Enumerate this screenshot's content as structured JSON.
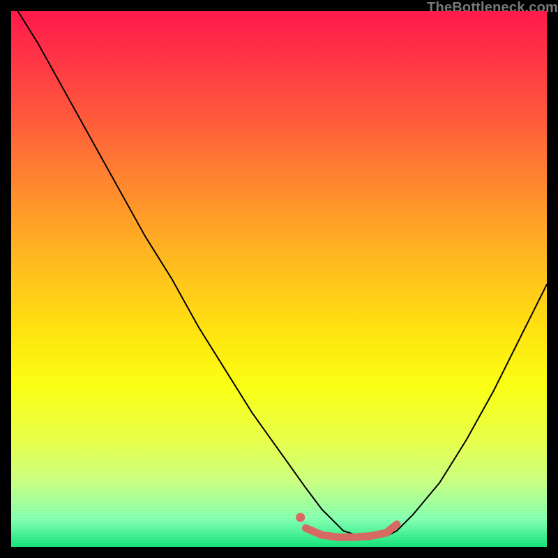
{
  "attribution": "TheBottleneck.com",
  "colors": {
    "curve": "#000000",
    "highlight": "#d66a63",
    "background_black": "#000000"
  },
  "chart_data": {
    "type": "line",
    "title": "",
    "xlabel": "",
    "ylabel": "",
    "xlim": [
      0,
      100
    ],
    "ylim": [
      0,
      100
    ],
    "series": [
      {
        "name": "bottleneck-curve",
        "x": [
          0,
          5,
          10,
          15,
          20,
          25,
          30,
          35,
          40,
          45,
          50,
          55,
          58,
          60,
          62,
          65,
          68,
          70,
          72,
          75,
          80,
          85,
          90,
          95,
          100
        ],
        "y": [
          102,
          94,
          85,
          76,
          67,
          58,
          50,
          41,
          33,
          25,
          18,
          11,
          7,
          5,
          3,
          2,
          2,
          2,
          3,
          6,
          12,
          20,
          29,
          39,
          49
        ]
      }
    ],
    "highlight_segment": {
      "x": [
        55,
        58,
        61,
        64,
        67,
        70,
        72
      ],
      "y": [
        3.5,
        2.2,
        1.8,
        1.8,
        2.0,
        2.6,
        4.2
      ]
    },
    "highlight_dot": {
      "x": 54,
      "y": 5.5
    }
  }
}
